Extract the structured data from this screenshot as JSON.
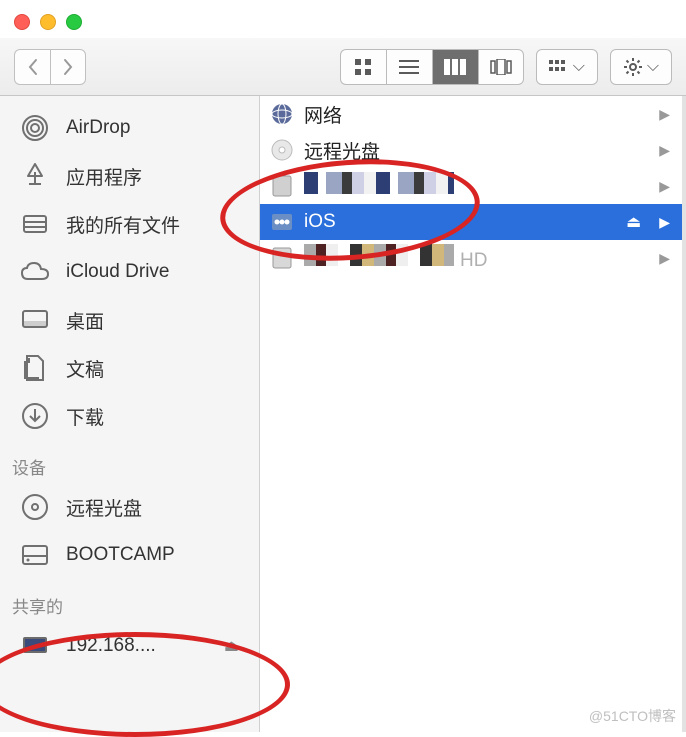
{
  "sidebar": {
    "favorites": [
      {
        "icon": "airdrop-icon",
        "label": "AirDrop"
      },
      {
        "icon": "apps-icon",
        "label": "应用程序"
      },
      {
        "icon": "allfiles-icon",
        "label": "我的所有文件"
      },
      {
        "icon": "icloud-icon",
        "label": "iCloud Drive"
      },
      {
        "icon": "desktop-icon",
        "label": "桌面"
      },
      {
        "icon": "documents-icon",
        "label": "文稿"
      },
      {
        "icon": "downloads-icon",
        "label": "下载"
      }
    ],
    "devices_header": "设备",
    "devices": [
      {
        "icon": "disc-icon",
        "label": "远程光盘"
      },
      {
        "icon": "hdd-icon",
        "label": "BOOTCAMP"
      }
    ],
    "shared_header": "共享的",
    "shared": [
      {
        "icon": "server-icon",
        "label": "192.168....",
        "eject": true
      }
    ]
  },
  "main": {
    "items": [
      {
        "icon": "network-icon",
        "label": "网络",
        "pixelated": false
      },
      {
        "icon": "disc-icon",
        "label": "远程光盘",
        "pixelated": false
      },
      {
        "icon": "hdd-icon",
        "label": "",
        "pixelated": true
      },
      {
        "icon": "shared-icon",
        "label": "iOS",
        "selected": true,
        "eject": true
      },
      {
        "icon": "hdd-icon",
        "label": "",
        "pixelated": true,
        "hd_suffix": "HD"
      }
    ]
  },
  "watermark": "@51CTO博客"
}
